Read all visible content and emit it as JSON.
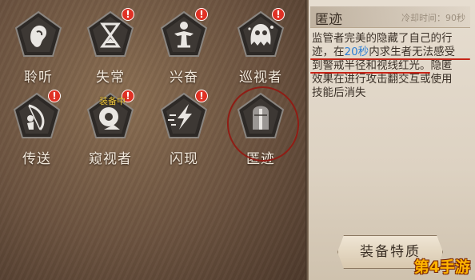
{
  "skills": [
    {
      "label": "聆听",
      "icon": "ear-icon",
      "alert": false
    },
    {
      "label": "失常",
      "icon": "hourglass-icon",
      "alert": true
    },
    {
      "label": "兴奋",
      "icon": "figure-icon",
      "alert": true
    },
    {
      "label": "巡视者",
      "icon": "ghost-icon",
      "alert": true
    },
    {
      "label": "传送",
      "icon": "bow-icon",
      "alert": true
    },
    {
      "label": "窥视者",
      "icon": "eye-icon",
      "alert": true,
      "equipped_tag": "装备中"
    },
    {
      "label": "闪现",
      "icon": "dash-icon",
      "alert": true
    },
    {
      "label": "匿迹",
      "icon": "helmet-icon",
      "alert": false,
      "selected": true
    }
  ],
  "alert_symbol": "!",
  "detail": {
    "title": "匿迹",
    "cooldown": "冷却时间：90秒",
    "desc_lines": [
      [
        "监管者完美的隐藏了自己的行"
      ],
      [
        "迹，在",
        "20秒",
        "内求生者无法感受"
      ],
      [
        "到警戒半径和视线红光。隐匿"
      ],
      [
        "效果在进行攻击翻交互或使用"
      ],
      [
        "技能后消失"
      ]
    ],
    "button_label": "装备特质"
  },
  "watermark": "第4手游",
  "colors": {
    "alert_red": "#e03124",
    "highlight_blue": "#2e7fd4",
    "mark_red": "#c62417"
  }
}
